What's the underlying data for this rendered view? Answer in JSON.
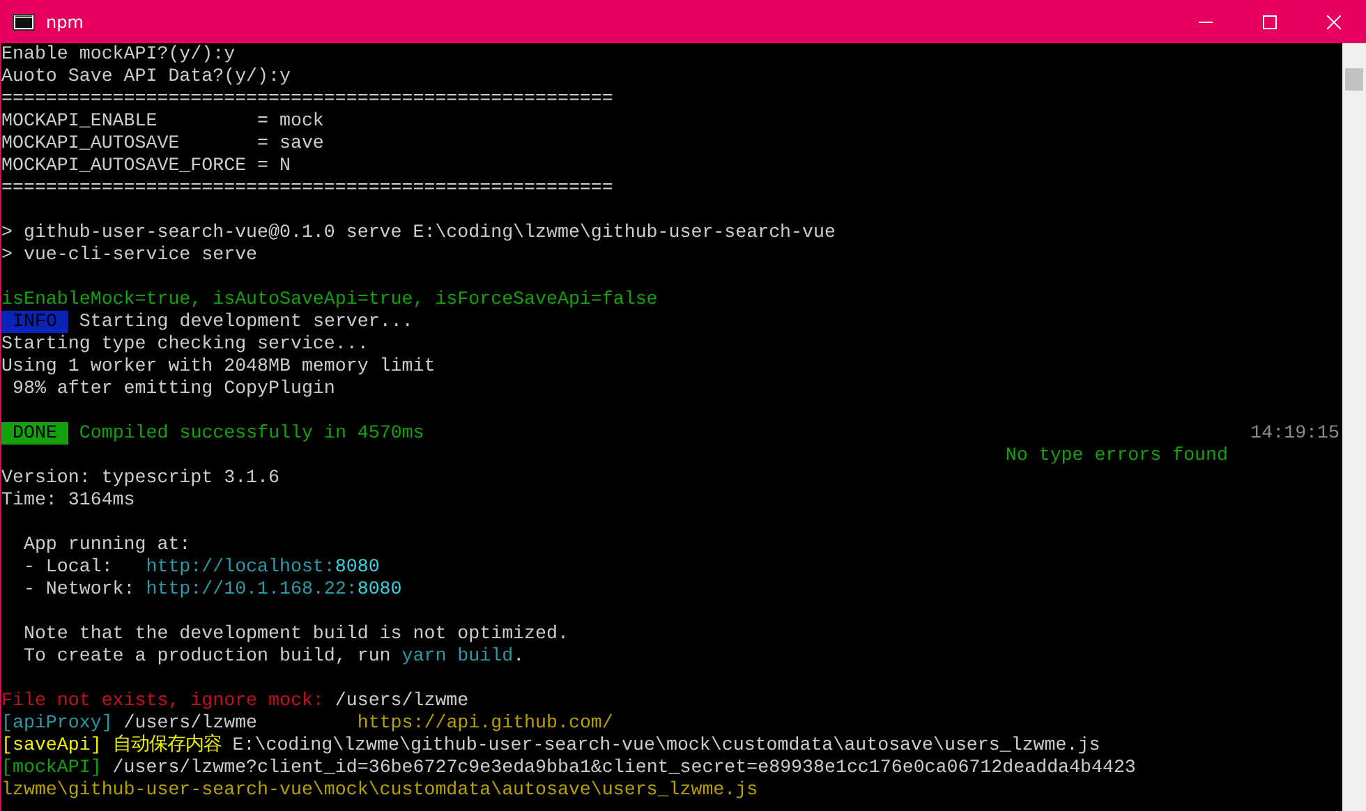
{
  "window": {
    "title": "npm"
  },
  "lines": [
    {
      "kind": "text",
      "segments": [
        {
          "text": "Enable mockAPI?(y/):y",
          "kind": "plain"
        }
      ]
    },
    {
      "kind": "text",
      "segments": [
        {
          "text": "Auoto Save API Data?(y/):y",
          "kind": "plain"
        }
      ]
    },
    {
      "kind": "text",
      "segments": [
        {
          "text": "=======================================================",
          "kind": "plain"
        }
      ]
    },
    {
      "kind": "text",
      "segments": [
        {
          "text": "MOCKAPI_ENABLE         = mock",
          "kind": "plain"
        }
      ]
    },
    {
      "kind": "text",
      "segments": [
        {
          "text": "MOCKAPI_AUTOSAVE       = save",
          "kind": "plain"
        }
      ]
    },
    {
      "kind": "text",
      "segments": [
        {
          "text": "MOCKAPI_AUTOSAVE_FORCE = N",
          "kind": "plain"
        }
      ]
    },
    {
      "kind": "text",
      "segments": [
        {
          "text": "=======================================================",
          "kind": "plain"
        }
      ]
    },
    {
      "kind": "blank"
    },
    {
      "kind": "text",
      "segments": [
        {
          "text": "> github-user-search-vue@0.1.0 serve E:\\coding\\lzwme\\github-user-search-vue",
          "kind": "plain"
        }
      ]
    },
    {
      "kind": "text",
      "segments": [
        {
          "text": "> vue-cli-service serve",
          "kind": "plain"
        }
      ]
    },
    {
      "kind": "blank"
    },
    {
      "kind": "text",
      "segments": [
        {
          "text": "isEnableMock=true, isAutoSaveApi=true, isForceSaveApi=false",
          "kind": "green"
        }
      ]
    },
    {
      "kind": "text",
      "segments": [
        {
          "text": "INFO",
          "kind": "badge-info"
        },
        {
          "text": "Starting development server...",
          "kind": "plain"
        }
      ]
    },
    {
      "kind": "text",
      "segments": [
        {
          "text": "Starting type checking service...",
          "kind": "plain"
        }
      ]
    },
    {
      "kind": "text",
      "segments": [
        {
          "text": "Using 1 worker with 2048MB memory limit",
          "kind": "plain"
        }
      ]
    },
    {
      "kind": "text",
      "segments": [
        {
          "text": " 98% after emitting CopyPlugin",
          "kind": "plain"
        }
      ]
    },
    {
      "kind": "blank"
    },
    {
      "kind": "text",
      "segments": [
        {
          "text": "DONE",
          "kind": "badge-done"
        },
        {
          "text": "Compiled successfully in 4570ms",
          "kind": "green"
        }
      ],
      "time": "14:19:15"
    },
    {
      "kind": "right",
      "segments": [
        {
          "text": "No type errors found",
          "kind": "green"
        }
      ]
    },
    {
      "kind": "text",
      "segments": [
        {
          "text": "Version: typescript 3.1.6",
          "kind": "plain"
        }
      ]
    },
    {
      "kind": "text",
      "segments": [
        {
          "text": "Time: 3164ms",
          "kind": "plain"
        }
      ]
    },
    {
      "kind": "blank"
    },
    {
      "kind": "text",
      "segments": [
        {
          "text": "  App running at:",
          "kind": "plain"
        }
      ]
    },
    {
      "kind": "text",
      "segments": [
        {
          "text": "  - Local:   ",
          "kind": "plain"
        },
        {
          "text": "http://localhost:",
          "kind": "teal"
        },
        {
          "text": "8080",
          "kind": "cyan"
        }
      ]
    },
    {
      "kind": "text",
      "segments": [
        {
          "text": "  - Network: ",
          "kind": "plain"
        },
        {
          "text": "http://10.1.168.22:",
          "kind": "teal"
        },
        {
          "text": "8080",
          "kind": "cyan"
        }
      ]
    },
    {
      "kind": "blank"
    },
    {
      "kind": "text",
      "segments": [
        {
          "text": "  Note that the development build is not optimized.",
          "kind": "plain"
        }
      ]
    },
    {
      "kind": "text",
      "segments": [
        {
          "text": "  To create a production build, run ",
          "kind": "plain"
        },
        {
          "text": "yarn build",
          "kind": "teal"
        },
        {
          "text": ".",
          "kind": "plain"
        }
      ]
    },
    {
      "kind": "blank"
    },
    {
      "kind": "text",
      "segments": [
        {
          "text": "File not exists, ignore mock:",
          "kind": "red"
        },
        {
          "text": " /users/lzwme",
          "kind": "plain"
        }
      ]
    },
    {
      "kind": "text",
      "segments": [
        {
          "text": "[apiProxy]",
          "kind": "teal"
        },
        {
          "text": " /users/lzwme         ",
          "kind": "plain"
        },
        {
          "text": "https://api.github.com/",
          "kind": "olive"
        }
      ]
    },
    {
      "kind": "text",
      "segments": [
        {
          "text": "[saveApi] 自动保存内容",
          "kind": "yellow"
        },
        {
          "text": " E:\\coding\\lzwme\\github-user-search-vue\\mock\\customdata\\autosave\\users_lzwme.js",
          "kind": "plain"
        }
      ]
    },
    {
      "kind": "text",
      "segments": [
        {
          "text": "[mockAPI]",
          "kind": "green"
        },
        {
          "text": " /users/lzwme?client_id=36be6727c9e3eda9bba1&client_secret=e89938e1cc176e0ca06712deadda4b4423",
          "kind": "plain"
        }
      ]
    },
    {
      "kind": "text",
      "segments": [
        {
          "text": "lzwme\\github-user-search-vue\\mock\\customdata\\autosave\\users_lzwme.js",
          "kind": "olive"
        }
      ]
    }
  ]
}
